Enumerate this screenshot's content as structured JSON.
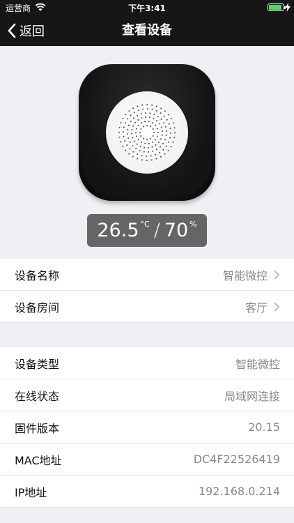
{
  "status_bar": {
    "carrier": "运营商",
    "time": "下午3:41"
  },
  "nav": {
    "back_label": "返回",
    "title": "查看设备"
  },
  "device": {
    "image": "sensor-device",
    "reading": {
      "temperature": "26.5",
      "temperature_unit": "°C",
      "separator": "/",
      "humidity": "70",
      "humidity_unit": "%"
    }
  },
  "group1": [
    {
      "label": "设备名称",
      "value": "智能微控"
    },
    {
      "label": "设备房间",
      "value": "客厅"
    }
  ],
  "group2": [
    {
      "label": "设备类型",
      "value": "智能微控"
    },
    {
      "label": "在线状态",
      "value": "局域网连接"
    },
    {
      "label": "固件版本",
      "value": "20.15"
    },
    {
      "label": "MAC地址",
      "value": "DC4F22526419"
    },
    {
      "label": "IP地址",
      "value": "192.168.0.214"
    }
  ],
  "colors": {
    "header_bg": "#161616",
    "page_bg": "#efeff4",
    "battery_fill": "#4cd964",
    "badge_bg": "#656565",
    "value_text": "#888888"
  }
}
